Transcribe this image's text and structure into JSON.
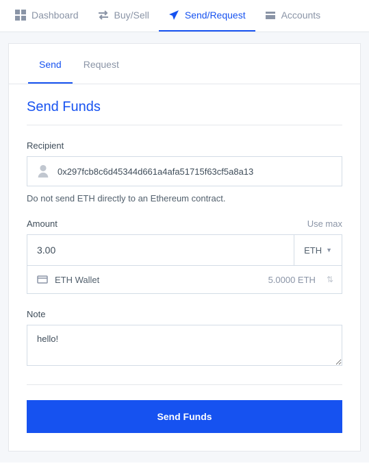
{
  "nav": {
    "dashboard": "Dashboard",
    "buysell": "Buy/Sell",
    "sendrequest": "Send/Request",
    "accounts": "Accounts"
  },
  "tabs": {
    "send": "Send",
    "request": "Request"
  },
  "heading": "Send Funds",
  "recipient": {
    "label": "Recipient",
    "value": "0x297fcb8c6d45344d661a4afa51715f63cf5a8a13",
    "hint": "Do not send ETH directly to an Ethereum contract."
  },
  "amount": {
    "label": "Amount",
    "use_max": "Use max",
    "value": "3.00",
    "currency": "ETH",
    "wallet_name": "ETH Wallet",
    "wallet_balance": "5.0000 ETH"
  },
  "note": {
    "label": "Note",
    "value": "hello!"
  },
  "submit_label": "Send Funds"
}
